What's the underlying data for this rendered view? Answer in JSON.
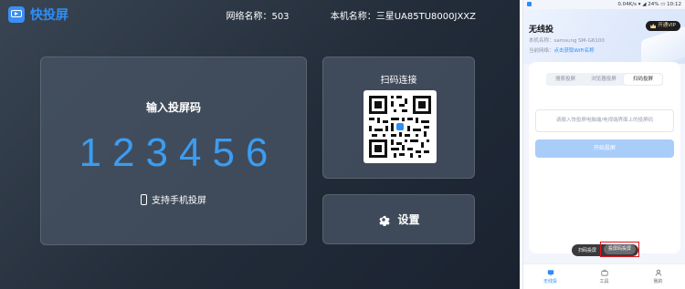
{
  "tv": {
    "app_name": "快投屏",
    "network_label": "网络名称：",
    "network_value": "503",
    "device_label": "本机名称：",
    "device_value": "三星UA85TU8000JXXZ",
    "code_title": "输入投屏码",
    "code_digits": "123456",
    "phone_cast_label": "支持手机投屏",
    "qr_title": "扫码连接",
    "settings_label": "设置",
    "accent_color": "#2e8ef5"
  },
  "phone": {
    "status_bar": {
      "speed": "0.04K/s",
      "battery": "24%",
      "time": "10:12"
    },
    "app_title": "无线投",
    "device_label": "本机名称：",
    "device_value": "samsung SM-G6100",
    "network_label": "当前网络：",
    "network_link": "点击获取WiFi名称",
    "vip_label": "开通VIP",
    "tabs": [
      {
        "label": "搜索投屏",
        "active": false
      },
      {
        "label": "浏览器投屏",
        "active": false
      },
      {
        "label": "扫码投屏",
        "active": true
      }
    ],
    "code_placeholder": "请输入快投屏电脑端/电视端界面上的投屏码",
    "start_button": "开始投屏",
    "mode_scan": "扫码投屏",
    "mode_code": "投屏码投屏",
    "nav": [
      {
        "label": "无线投",
        "icon": "cast-icon",
        "active": true
      },
      {
        "label": "工具",
        "icon": "toolbox-icon",
        "active": false
      },
      {
        "label": "我的",
        "icon": "user-icon",
        "active": false
      }
    ]
  }
}
